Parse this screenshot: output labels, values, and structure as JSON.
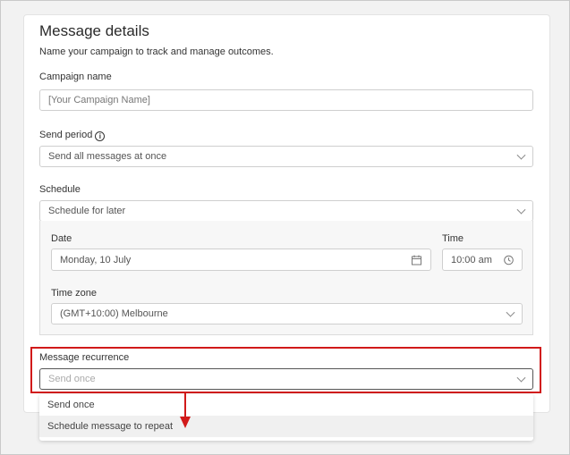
{
  "form": {
    "title": "Message details",
    "subtitle": "Name your campaign to track and manage outcomes.",
    "campaign_name": {
      "label": "Campaign name",
      "value": "[Your Campaign Name]"
    },
    "send_period": {
      "label": "Send period",
      "value": "Send all messages at once",
      "info_icon": "info-icon"
    },
    "schedule": {
      "label": "Schedule",
      "value": "Schedule for later",
      "date": {
        "label": "Date",
        "value": "Monday, 10 July"
      },
      "time": {
        "label": "Time",
        "value": "10:00 am"
      },
      "timezone": {
        "label": "Time zone",
        "value": "(GMT+10:00) Melbourne"
      }
    },
    "recurrence": {
      "label": "Message recurrence",
      "placeholder": "Send once",
      "options": [
        "Send once",
        "Schedule message to repeat"
      ]
    }
  },
  "annotation": {
    "highlight_color": "#d11a1a",
    "arrow_color": "#d11a1a"
  }
}
